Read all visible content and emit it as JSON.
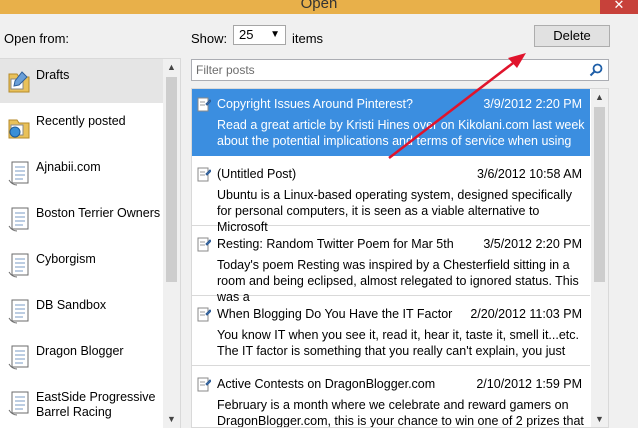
{
  "window": {
    "title": "Open",
    "close_glyph": "✕"
  },
  "toolbar": {
    "open_from_label": "Open from:",
    "show_label": "Show:",
    "show_value": "25",
    "items_label": "items",
    "delete_label": "Delete"
  },
  "filter": {
    "placeholder": "Filter posts"
  },
  "blogs": [
    {
      "label": "Drafts",
      "icon": "drafts-folder-icon"
    },
    {
      "label": "Recently posted",
      "icon": "recent-folder-icon"
    },
    {
      "label": "Ajnabii.com",
      "icon": "blog-document-icon"
    },
    {
      "label": "Boston Terrier Owners",
      "icon": "blog-document-icon"
    },
    {
      "label": "Cyborgism",
      "icon": "blog-document-icon"
    },
    {
      "label": "DB Sandbox",
      "icon": "blog-document-icon"
    },
    {
      "label": "Dragon Blogger",
      "icon": "blog-document-icon"
    },
    {
      "label": "EastSide Progressive Barrel Racing",
      "icon": "blog-document-icon"
    }
  ],
  "posts": [
    {
      "title": "Copyright Issues Around Pinterest?",
      "date": "3/9/2012 2:20 PM",
      "excerpt": "Read a great article by Kristi Hines over on Kikolani.com last week about the potential implications and terms of service when using"
    },
    {
      "title": "(Untitled Post)",
      "date": "3/6/2012 10:58 AM",
      "excerpt": "Ubuntu is a Linux-based operating system, designed specifically for personal computers, it is seen as a viable alternative to Microsoft"
    },
    {
      "title": "Resting: Random Twitter Poem for Mar 5th",
      "date": "3/5/2012 2:20 PM",
      "excerpt": "Today's poem Resting was inspired by a Chesterfield sitting in a room and being eclipsed, almost relegated to ignored status.  This was a"
    },
    {
      "title": "When Blogging Do You Have the IT Factor",
      "date": "2/20/2012 11:03 PM",
      "excerpt": "You know IT when you see it, read it, hear it, taste it, smell it...etc. The IT factor is something that you really can't explain, you just"
    },
    {
      "title": "Active Contests on DragonBlogger.com",
      "date": "2/10/2012 1:59 PM",
      "excerpt": "February is a month where we celebrate and reward gamers on DragonBlogger.com, this is your chance to win one of 2 prizes that"
    }
  ],
  "colors": {
    "selection": "#3b8ee0",
    "annotation_arrow": "#e0142c"
  }
}
